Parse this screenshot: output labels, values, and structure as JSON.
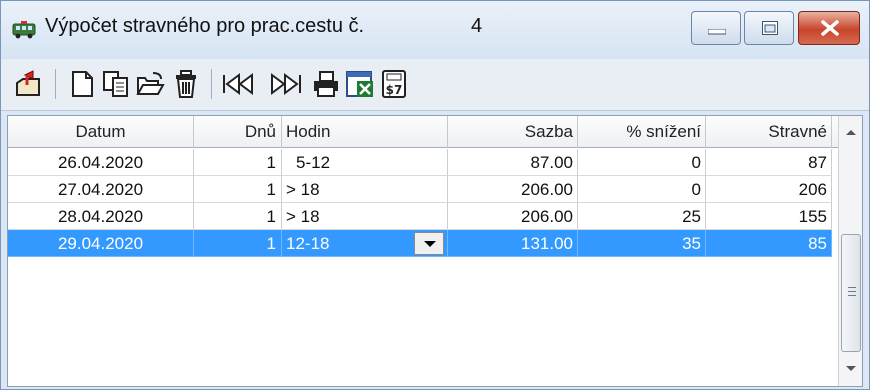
{
  "window": {
    "title": "Výpočet stravného pro prac.cestu č.",
    "trip_number": "4",
    "controls": [
      "minimize-icon",
      "maximize-icon",
      "close-icon"
    ],
    "accent_close": "#c8452b",
    "selection_color": "#3399ff"
  },
  "toolbar": {
    "icons": [
      "exit-icon",
      "new-document-icon",
      "copy-icon",
      "open-folder-icon",
      "delete-trash-icon",
      "first-record-icon",
      "last-record-icon",
      "print-icon",
      "excel-export-icon",
      "calculator-icon"
    ]
  },
  "grid": {
    "columns": [
      "Datum",
      "Dnů",
      "Hodin",
      "Sazba",
      "% snížení",
      "Stravné"
    ],
    "rows": [
      {
        "datum": "26.04.2020",
        "dnu": "1",
        "hodin": "5-12",
        "sazba": "87.00",
        "snizeni": "0",
        "stravne": "87"
      },
      {
        "datum": "27.04.2020",
        "dnu": "1",
        "hodin": "> 18",
        "sazba": "206.00",
        "snizeni": "0",
        "stravne": "206"
      },
      {
        "datum": "28.04.2020",
        "dnu": "1",
        "hodin": "> 18",
        "sazba": "206.00",
        "snizeni": "25",
        "stravne": "155"
      },
      {
        "datum": "29.04.2020",
        "dnu": "1",
        "hodin": "12-18",
        "sazba": "131.00",
        "snizeni": "35",
        "stravne": "85"
      }
    ],
    "selected_row": 4
  }
}
